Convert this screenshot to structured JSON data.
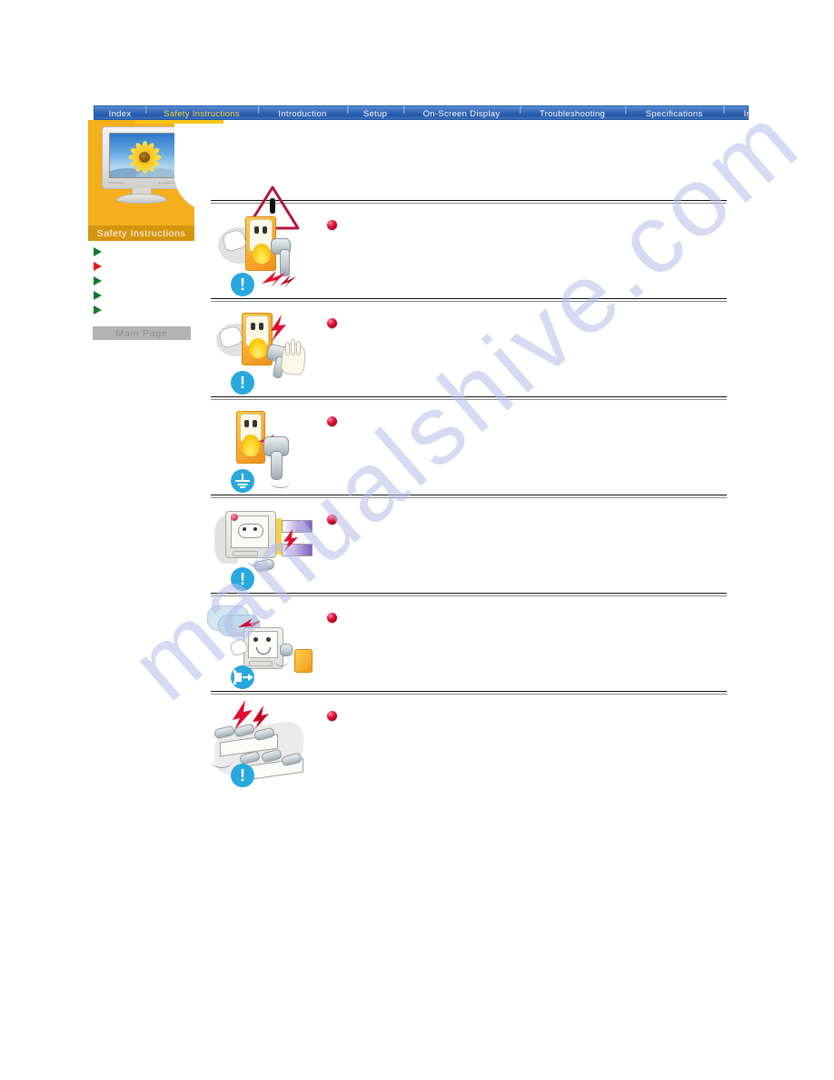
{
  "page": {
    "background_color": "#ffffff",
    "watermark_text": "manualshive.com",
    "watermark_color": "#b9bdea"
  },
  "navbar": {
    "background_color": "#2f63b4",
    "active_color": "#ffd64a",
    "separator": "|",
    "items": [
      {
        "label": "Index",
        "active": false
      },
      {
        "label": "Safety Instructions",
        "active": true
      },
      {
        "label": "Introduction",
        "active": false
      },
      {
        "label": "Setup",
        "active": false
      },
      {
        "label": "On-Screen Display",
        "active": false
      },
      {
        "label": "Troubleshooting",
        "active": false
      },
      {
        "label": "Specifications",
        "active": false
      },
      {
        "label": "Information",
        "active": false
      }
    ]
  },
  "sidebar": {
    "panel_color": "#f5ae1d",
    "caption": "Safety Instructions",
    "caption_background": "#d6950f",
    "monitor_brand": "SAMSUNG",
    "monitor_model": "SyncMaster",
    "links": [
      {
        "label": "",
        "marker_color": "#157a2e",
        "active": false
      },
      {
        "label": "",
        "marker_color": "#e81616",
        "active": true
      },
      {
        "label": "",
        "marker_color": "#157a2e",
        "active": false
      },
      {
        "label": "",
        "marker_color": "#157a2e",
        "active": false
      },
      {
        "label": "",
        "marker_color": "#157a2e",
        "active": false
      }
    ],
    "main_page_button": "Main Page"
  },
  "content": {
    "warning_symbol": "warning-triangle",
    "bullet_color": "#e8143c",
    "rows": [
      {
        "id": "row-1",
        "illustration": "plug-pulled-from-outlet",
        "symbol": "exclamation",
        "symbol_color": "#29a8dd",
        "text": ""
      },
      {
        "id": "row-2",
        "illustration": "wet-hand-touching-plug",
        "symbol": "exclamation",
        "symbol_color": "#29a8dd",
        "text": ""
      },
      {
        "id": "row-3",
        "illustration": "grounded-plug-in-outlet",
        "symbol": "ground",
        "symbol_color": "#29a8dd",
        "text": ""
      },
      {
        "id": "row-4",
        "illustration": "monitor-damaged-power-cord",
        "symbol": "exclamation",
        "symbol_color": "#29a8dd",
        "text": ""
      },
      {
        "id": "row-5",
        "illustration": "monitor-thunderstorm-unplug",
        "symbol": "unplug",
        "symbol_color": "#29a8dd",
        "text": ""
      },
      {
        "id": "row-6",
        "illustration": "overloaded-power-strips",
        "symbol": "exclamation",
        "symbol_color": "#29a8dd",
        "text": ""
      }
    ]
  }
}
